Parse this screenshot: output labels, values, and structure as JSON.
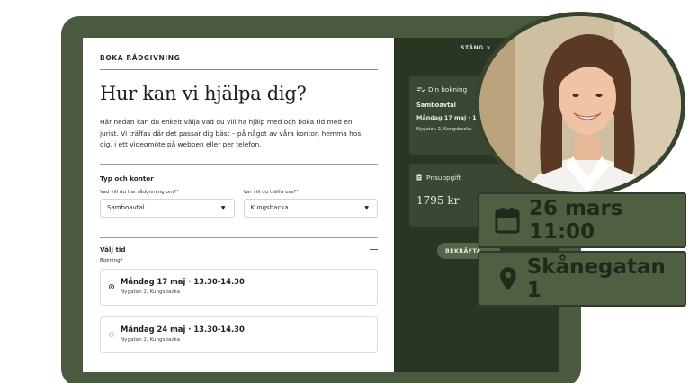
{
  "form": {
    "eyebrow": "BOKA RÅDGIVNING",
    "title": "Hur kan vi hjälpa dig?",
    "intro": "Här nedan kan du enkelt välja vad du vill ha hjälp med och boka tid med en jurist. Vi träffas där det passar dig bäst – på något av våra kontor, hemma hos dig, i ett videomöte på webben eller per telefon.",
    "type_section": "Typ och kontor",
    "field_topic_label": "Vad vill du har rådgivning om?*",
    "field_topic_value": "Samboavtal",
    "field_office_label": "Var vill du träffa oss?*",
    "field_office_value": "Kungsbacka",
    "time_section": "Välj tid",
    "booking_label": "Bokning*",
    "slots": [
      {
        "title": "Måndag 17 maj · 13.30-14.30",
        "address": "Nygatan 2, Kungsbacka",
        "selected": true
      },
      {
        "title": "Måndag 24 maj · 13.30-14.30",
        "address": "Nygatan 2, Kungsbacka",
        "selected": false
      }
    ]
  },
  "panel": {
    "close": "STÄNG ×",
    "booking_title": "Din bokning",
    "booking_service": "Samboavtal",
    "booking_time": "Måndag 17 maj · 13.30-14.30",
    "booking_address": "Nygatan 2, Kungsbacka",
    "price_title": "Prisuppgift",
    "price_value": "1795 kr",
    "confirm_label": "BEKRÄFTA"
  },
  "chips": {
    "date": "26 mars 11:00",
    "place": "Skånegatan 1"
  },
  "colors": {
    "frame": "#4a5a3e",
    "panel_dark": "#2a3524",
    "card": "#3a4733",
    "chip_bg": "#4e5f42",
    "chip_text": "#1f2a1a"
  },
  "icons": [
    "calendar-icon",
    "location-pin-icon",
    "booking-icon",
    "price-icon",
    "caret-down-icon"
  ]
}
